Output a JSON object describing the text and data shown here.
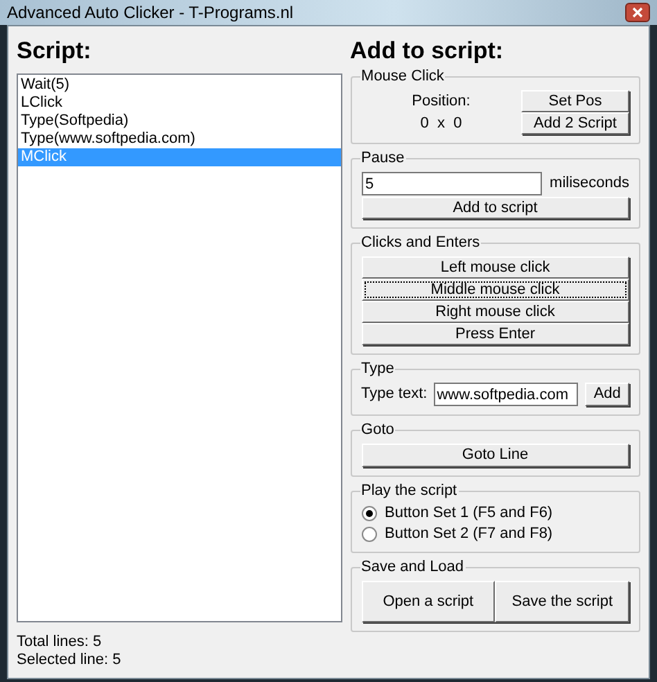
{
  "window": {
    "title": "Advanced Auto Clicker - T-Programs.nl"
  },
  "script": {
    "heading": "Script:",
    "items": [
      {
        "text": "Wait(5)",
        "selected": false
      },
      {
        "text": "LClick",
        "selected": false
      },
      {
        "text": "Type(Softpedia)",
        "selected": false
      },
      {
        "text": "Type(www.softpedia.com)",
        "selected": false
      },
      {
        "text": "MClick",
        "selected": true
      }
    ],
    "total_lines": "Total lines: 5",
    "selected_line": "Selected line: 5"
  },
  "add": {
    "heading": "Add to script:",
    "mouse_click": {
      "title": "Mouse Click",
      "position_label": "Position:",
      "position_value": "0  x  0",
      "buttons": [
        "Set Pos",
        "Add 2 Script"
      ]
    },
    "pause": {
      "title": "Pause",
      "value": "5",
      "unit": "miliseconds",
      "button": "Add to script"
    },
    "clicks": {
      "title": "Clicks and Enters",
      "buttons": [
        {
          "label": "Left mouse click",
          "focused": false
        },
        {
          "label": "Middle mouse click",
          "focused": true
        },
        {
          "label": "Right mouse click",
          "focused": false
        },
        {
          "label": "Press Enter",
          "focused": false
        }
      ]
    },
    "type": {
      "title": "Type",
      "label": "Type text:",
      "value": "www.softpedia.com",
      "button": "Add"
    },
    "goto": {
      "title": "Goto",
      "button": "Goto Line"
    },
    "play": {
      "title": "Play the script",
      "options": [
        {
          "label": "Button Set 1 (F5 and F6)",
          "selected": true
        },
        {
          "label": "Button Set 2 (F7 and F8)",
          "selected": false
        }
      ]
    },
    "save_load": {
      "title": "Save and Load",
      "buttons": [
        "Open a script",
        "Save the script"
      ]
    }
  }
}
